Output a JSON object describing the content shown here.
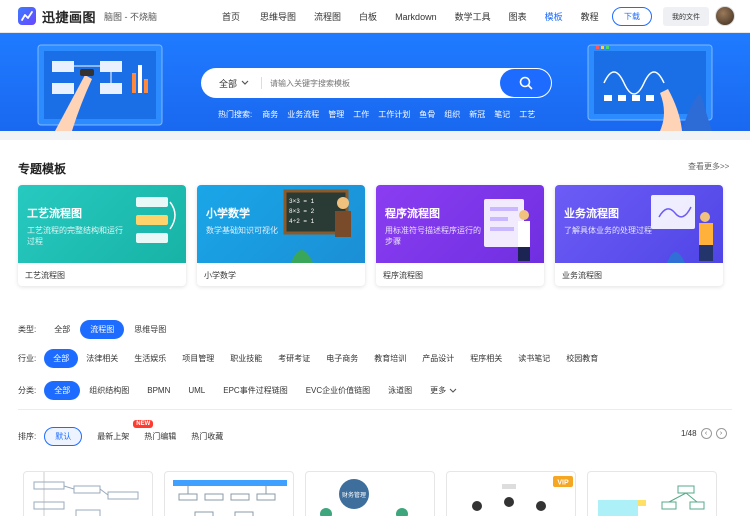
{
  "header": {
    "logo_text": "迅捷画图",
    "logo_sub": "脑图 - 不烧脑",
    "nav": [
      {
        "label": "首页",
        "active": false
      },
      {
        "label": "思维导图",
        "active": false
      },
      {
        "label": "流程图",
        "active": false
      },
      {
        "label": "白板",
        "active": false
      },
      {
        "label": "Markdown",
        "active": false
      },
      {
        "label": "数学工具",
        "active": false
      },
      {
        "label": "图表",
        "active": false
      },
      {
        "label": "模板",
        "active": true
      },
      {
        "label": "教程",
        "active": false
      }
    ],
    "download_label": "下载",
    "my_files_label": "我的文件"
  },
  "banner": {
    "search_category": "全部",
    "search_placeholder": "请输入关键字搜索模板",
    "hot_label": "热门搜索:",
    "hot_tags": [
      "商务",
      "业务流程",
      "管理",
      "工作",
      "工作计划",
      "鱼骨",
      "组织",
      "新冠",
      "笔记",
      "工艺"
    ]
  },
  "featured": {
    "title": "专题模板",
    "more": "查看更多>>",
    "cards": [
      {
        "title": "工艺流程图",
        "desc": "工艺流程的完整结构和运行过程",
        "caption": "工艺流程图",
        "color_from": "#27c9c0",
        "color_to": "#17b3a6"
      },
      {
        "title": "小学数学",
        "desc": "数学基础知识可视化",
        "caption": "小学数学",
        "color_from": "#1aa6e8",
        "color_to": "#1b8fd6"
      },
      {
        "title": "程序流程图",
        "desc": "用标准符号描述程序运行的步骤",
        "caption": "程序流程图",
        "color_from": "#8b3df2",
        "color_to": "#6f2fe0"
      },
      {
        "title": "业务流程图",
        "desc": "了解具体业务的处理过程",
        "caption": "业务流程图",
        "color_from": "#6d5cf6",
        "color_to": "#4f45e6"
      }
    ]
  },
  "filters": {
    "type": {
      "label": "类型:",
      "options": [
        "全部",
        "流程图",
        "思维导图"
      ],
      "active": 1
    },
    "industry": {
      "label": "行业:",
      "options": [
        "全部",
        "法律相关",
        "生活娱乐",
        "项目管理",
        "职业技能",
        "考研考证",
        "电子商务",
        "教育培训",
        "产品设计",
        "程序相关",
        "读书笔记",
        "校园教育"
      ],
      "active": 0
    },
    "category": {
      "label": "分类:",
      "options": [
        "全部",
        "组织结构图",
        "BPMN",
        "UML",
        "EPC事件过程链图",
        "EVC企业价值链图",
        "泳道图",
        "更多"
      ],
      "active": 0
    }
  },
  "sort": {
    "label": "排序:",
    "default": "默认",
    "items": [
      "最新上架",
      "热门编辑",
      "热门收藏"
    ],
    "new_badge": "NEW",
    "pager": "1/48"
  },
  "thumbs": {
    "finance_label": "财务管理",
    "vip_label": "VIP"
  },
  "colors": {
    "primary": "#1e6cff",
    "banner": "#1f7bff"
  }
}
